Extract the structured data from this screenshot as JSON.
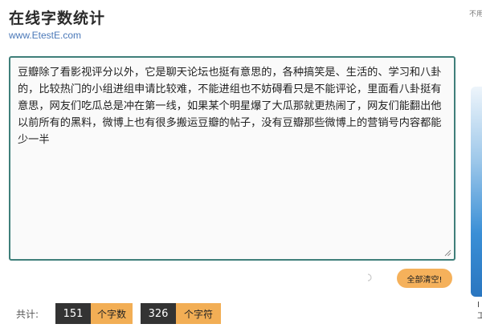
{
  "header": {
    "title": "在线字数统计",
    "url": "www.EtestE.com"
  },
  "right_note": "不用",
  "editor": {
    "content": "豆瓣除了看影视评分以外，它是聊天论坛也挺有意思的，各种搞笑是、生活的、学习和八卦的，比较热门的小组进组申请比较难，不能进组也不妨碍看只是不能评论，里面看八卦挺有意思，网友们吃瓜总是冲在第一线，如果某个明星爆了大瓜那就更热闹了，网友们能翻出他以前所有的黑料，微博上也有很多搬运豆瓣的帖子，没有豆瓣那些微博上的营销号内容都能少一半"
  },
  "actions": {
    "clear_label": "全部清空!"
  },
  "stats": {
    "total_label": "共计:",
    "word_count": "151",
    "word_unit": "个字数",
    "char_count": "326",
    "char_unit": "个字符"
  },
  "side": {
    "text_1": "I",
    "text_2": "工"
  },
  "colors": {
    "accent": "#f2ae55",
    "dark": "#333333",
    "editor_border": "#3f7f7a",
    "link": "#4a78b8"
  },
  "icons": [
    "loading-spinner-icon",
    "resize-handle-icon"
  ]
}
